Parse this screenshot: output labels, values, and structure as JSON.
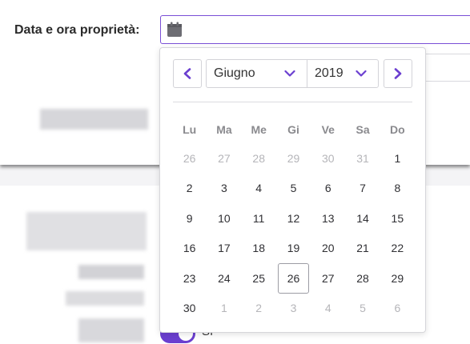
{
  "form": {
    "date_label": "Data e ora proprietà:",
    "toggle_label": "Sì"
  },
  "icons": {
    "date_input_icon": "calendar-icon",
    "prev": "chevron-left-icon",
    "next": "chevron-right-icon",
    "dropdown": "chevron-down-icon"
  },
  "colors": {
    "accent": "#6b3fd0",
    "muted_day": "#b5b5b9",
    "weekday": "#8a8a8e"
  },
  "datepicker": {
    "month": "Giugno",
    "year": "2019",
    "weekdays": [
      "Lu",
      "Ma",
      "Me",
      "Gi",
      "Ve",
      "Sa",
      "Do"
    ],
    "weeks": [
      [
        {
          "d": "26",
          "other": true
        },
        {
          "d": "27",
          "other": true
        },
        {
          "d": "28",
          "other": true
        },
        {
          "d": "29",
          "other": true
        },
        {
          "d": "30",
          "other": true
        },
        {
          "d": "31",
          "other": true
        },
        {
          "d": "1"
        }
      ],
      [
        {
          "d": "2"
        },
        {
          "d": "3"
        },
        {
          "d": "4"
        },
        {
          "d": "5"
        },
        {
          "d": "6"
        },
        {
          "d": "7"
        },
        {
          "d": "8"
        }
      ],
      [
        {
          "d": "9"
        },
        {
          "d": "10"
        },
        {
          "d": "11"
        },
        {
          "d": "12"
        },
        {
          "d": "13"
        },
        {
          "d": "14"
        },
        {
          "d": "15"
        }
      ],
      [
        {
          "d": "16"
        },
        {
          "d": "17"
        },
        {
          "d": "18"
        },
        {
          "d": "19"
        },
        {
          "d": "20"
        },
        {
          "d": "21"
        },
        {
          "d": "22"
        }
      ],
      [
        {
          "d": "23"
        },
        {
          "d": "24"
        },
        {
          "d": "25"
        },
        {
          "d": "26",
          "current": true
        },
        {
          "d": "27"
        },
        {
          "d": "28"
        },
        {
          "d": "29"
        }
      ],
      [
        {
          "d": "30"
        },
        {
          "d": "1",
          "other": true
        },
        {
          "d": "2",
          "other": true
        },
        {
          "d": "3",
          "other": true
        },
        {
          "d": "4",
          "other": true
        },
        {
          "d": "5",
          "other": true
        },
        {
          "d": "6",
          "other": true
        }
      ]
    ]
  }
}
